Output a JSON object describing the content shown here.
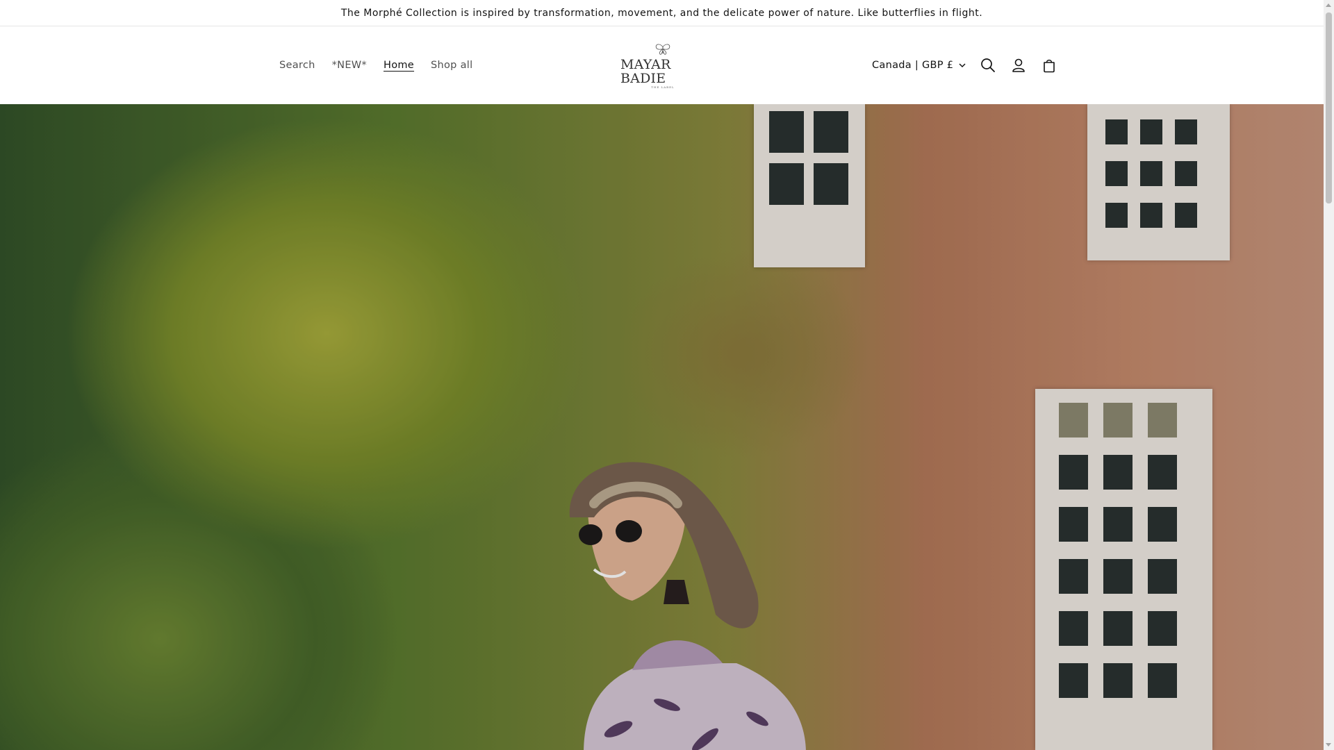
{
  "announcement": {
    "text": "The Morphé Collection is inspired by transformation, movement, and the delicate power of nature. Like butterflies in flight."
  },
  "header": {
    "nav": [
      {
        "label": "Search",
        "active": false
      },
      {
        "label": "*NEW*",
        "active": false
      },
      {
        "label": "Home",
        "active": true
      },
      {
        "label": "Shop all",
        "active": false
      }
    ],
    "logo": {
      "brand": "MAYAR BADIE",
      "sub": "THE LABEL"
    },
    "country_selector": {
      "value": "Canada | GBP £",
      "icon": "chevron-down-icon"
    },
    "icons": [
      "search-icon",
      "account-icon",
      "cart-icon"
    ]
  },
  "hero": {
    "image_alt": "",
    "colors": {
      "foliage": "#7c8e2c",
      "brick": "#c58a6c",
      "window_frame": "#f1ebe4"
    }
  }
}
